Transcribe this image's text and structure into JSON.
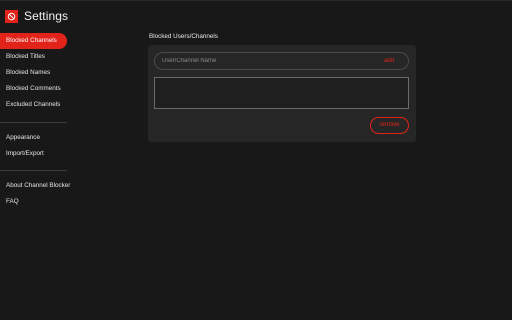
{
  "app": {
    "title": "Settings",
    "brand_color": "#e2231a",
    "logo_icon": "no-entry-icon"
  },
  "sidebar": {
    "groups": [
      {
        "items": [
          {
            "label": "Blocked Channels",
            "active": true
          },
          {
            "label": "Blocked Titles",
            "active": false
          },
          {
            "label": "Blocked Names",
            "active": false
          },
          {
            "label": "Blocked Comments",
            "active": false
          },
          {
            "label": "Excluded Channels",
            "active": false
          }
        ]
      },
      {
        "items": [
          {
            "label": "Appearance",
            "active": false
          },
          {
            "label": "Import/Export",
            "active": false
          }
        ]
      },
      {
        "items": [
          {
            "label": "About Channel Blocker",
            "active": false
          },
          {
            "label": "FAQ",
            "active": false
          }
        ]
      }
    ]
  },
  "main": {
    "section_title": "Blocked Users/Channels",
    "input": {
      "placeholder": "User/Channel Name",
      "value": ""
    },
    "add_label": "add",
    "remove_label": "remove",
    "blocked_list": []
  }
}
